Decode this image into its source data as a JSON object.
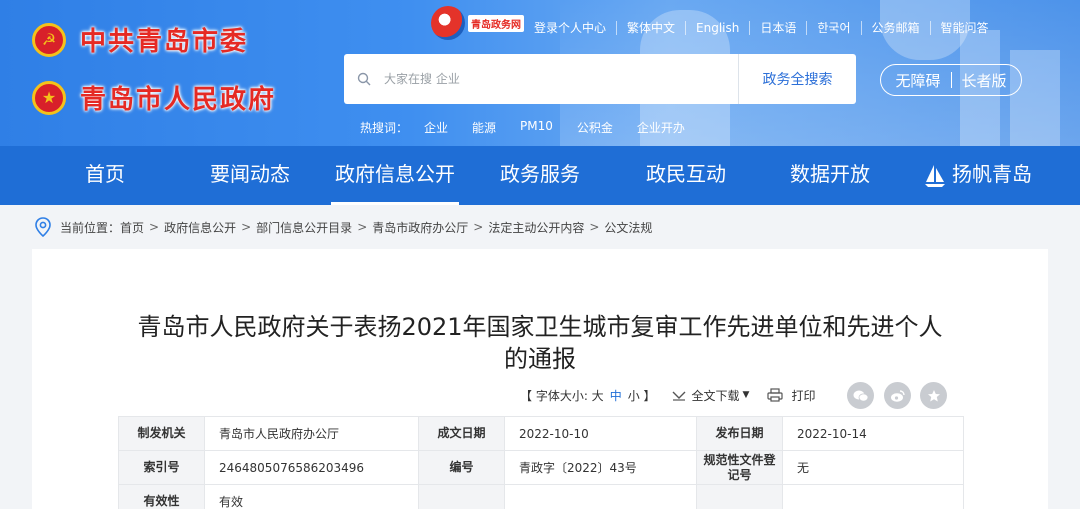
{
  "header": {
    "party_title": "中共青岛市委",
    "gov_title": "青岛市人民政府",
    "site_badge": "青岛政务网",
    "top_links": [
      "登录个人中心",
      "繁体中文",
      "English",
      "日本语",
      "한국어",
      "公务邮箱",
      "智能问答"
    ],
    "search_placeholder": "大家在搜 企业",
    "search_button": "政务全搜索",
    "access_links": [
      "无障碍",
      "长者版"
    ],
    "hot_label": "热搜词：",
    "hot_words": [
      "企业",
      "能源",
      "PM10",
      "公积金",
      "企业开办"
    ]
  },
  "nav": {
    "items": [
      "首页",
      "要闻动态",
      "政府信息公开",
      "政务服务",
      "政民互动",
      "数据开放",
      "扬帆青岛"
    ],
    "active_index": 2
  },
  "breadcrumb": {
    "label": "当前位置：",
    "items": [
      "首页",
      "政府信息公开",
      "部门信息公开目录",
      "青岛市政府办公厅",
      "法定主动公开内容",
      "公文法规"
    ]
  },
  "article": {
    "title_line1": "青岛市人民政府关于表扬2021年国家卫生城市复审工作先进单位和先进个人",
    "title_line2": "的通报",
    "font_size_label": "【 字体大小: 大",
    "font_mid": "中",
    "font_small": "小 】",
    "download": "全文下载",
    "print": "打印"
  },
  "meta": {
    "rows": [
      [
        {
          "k": "制发机关",
          "v": "青岛市人民政府办公厅"
        },
        {
          "k": "成文日期",
          "v": "2022-10-10"
        },
        {
          "k": "发布日期",
          "v": "2022-10-14"
        }
      ],
      [
        {
          "k": "索引号",
          "v": "2464805076586203496"
        },
        {
          "k": "编号",
          "v": "青政字〔2022〕43号"
        },
        {
          "k": "规范性文件登记号",
          "v": "无"
        }
      ],
      [
        {
          "k": "有效性",
          "v": "有效"
        },
        {
          "k": "",
          "v": ""
        },
        {
          "k": "",
          "v": ""
        }
      ]
    ]
  },
  "colors": {
    "nav_blue": "#1f6ed6",
    "banner_blue": "#3f8ff0",
    "party_red": "#e52a24"
  }
}
